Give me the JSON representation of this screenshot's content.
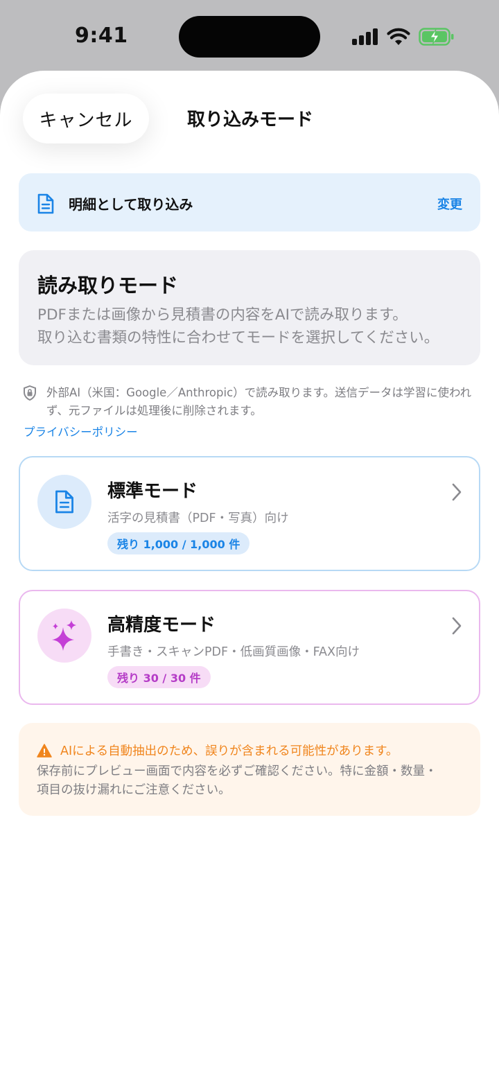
{
  "status_bar": {
    "time": "9:41"
  },
  "header": {
    "cancel_label": "キャンセル",
    "title": "取り込みモード"
  },
  "import_target": {
    "label": "明細として取り込み",
    "change_label": "変更"
  },
  "reading_info": {
    "title": "読み取りモード",
    "line1": "PDFまたは画像から見積書の内容をAIで読み取ります。",
    "line2": "取り込む書類の特性に合わせてモードを選択してください。"
  },
  "privacy": {
    "text": "外部AI（米国：Google／Anthropic）で読み取ります。送信データは学習に使われず、元ファイルは処理後に削除されます。",
    "link_label": "プライバシーポリシー"
  },
  "modes": [
    {
      "name": "標準モード",
      "description": "活字の見積書（PDF・写真）向け",
      "remaining_label": "残り 1,000 / 1,000 件",
      "accent": "#1a84e6"
    },
    {
      "name": "高精度モード",
      "description": "手書き・スキャンPDF・低画質画像・FAX向け",
      "remaining_label": "残り 30 / 30 件",
      "accent": "#b53dc7"
    }
  ],
  "warning": {
    "headline": "AIによる自動抽出のため、誤りが含まれる可能性があります。",
    "line1": "保存前にプレビュー画面で内容を必ずご確認ください。特に金額・数量・",
    "line2": "項目の抜け漏れにご注意ください。",
    "color": "#f0851d"
  }
}
